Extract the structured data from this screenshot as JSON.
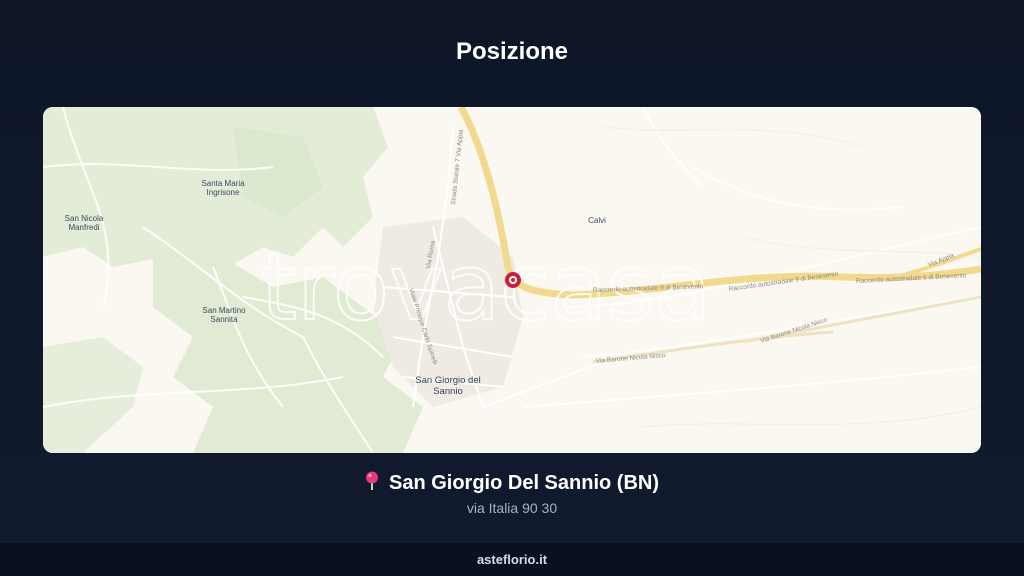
{
  "header": {
    "title": "Posizione"
  },
  "map": {
    "watermark": "trovacasa",
    "places": {
      "santa_maria_1": "Santa Maria",
      "santa_maria_2": "Ingrisone",
      "san_nicola_1": "San Nicola",
      "san_nicola_2": "Manfredi",
      "san_martino_1": "San Martino",
      "san_martino_2": "Sannita",
      "calvi": "Calvi",
      "san_giorgio_1": "San Giorgio del",
      "san_giorgio_2": "Sannio"
    },
    "roads": {
      "ss7": "Strada Statale 7 Via Appia",
      "via_roma": "Via Roma",
      "via_principe": "Viale Principe Carlo Spinelli",
      "raccordo_1": "Raccordo autostradale 9 di Benevento",
      "raccordo_2": "Raccordo autostradale 9 di Benevento",
      "raccordo_3": "Raccordo autostradale 9 di Benevento",
      "via_appia": "Via Appia",
      "via_barone_1": "Via Barone Nicola Nisco",
      "via_barone_2": "Via Barone Nicola Nisco"
    }
  },
  "location": {
    "name": "San Giorgio Del Sannio (BN)",
    "address": "via Italia 90 30",
    "pin_icon": "pin-icon"
  },
  "footer": {
    "site": "asteflorio.it"
  }
}
